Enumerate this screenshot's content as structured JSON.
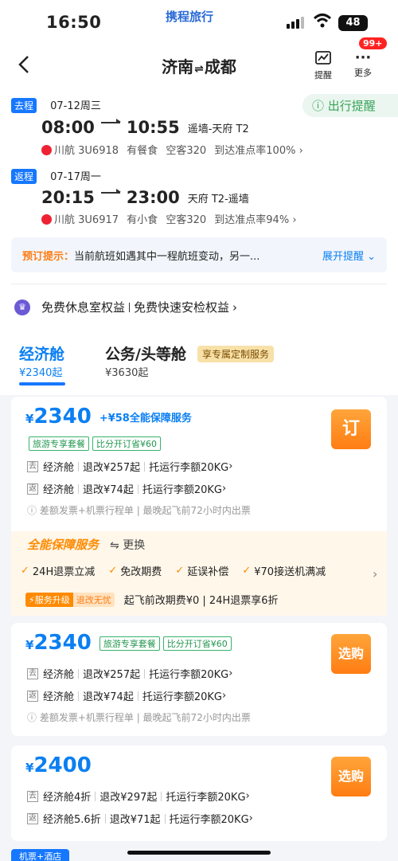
{
  "status": {
    "time": "16:50",
    "brand": "携程旅行",
    "battery": "48"
  },
  "header": {
    "route_from": "济南",
    "route_to": "成都",
    "remind_label": "提醒",
    "more_label": "更多",
    "badge": "99+"
  },
  "outbound": {
    "tag": "去程",
    "date": "07-12周三",
    "depart": "08:00",
    "arrive": "10:55",
    "airports": "遥墙-天府 T2",
    "airline": "川航 3U6918",
    "meal": "有餐食",
    "aircraft": "空客320",
    "ontime": "到达准点率100%"
  },
  "trip_remind": "出行提醒",
  "return": {
    "tag": "返程",
    "date": "07-17周一",
    "depart": "20:15",
    "arrive": "23:00",
    "airports": "天府 T2-遥墙",
    "airline": "川航 3U6917",
    "meal": "有小食",
    "aircraft": "空客320",
    "ontime": "到达准点率94%"
  },
  "tip": {
    "label": "预订提示：",
    "text": "当前航班如遇其中一程航班变动，另一...",
    "expand": "展开提醒"
  },
  "perks": {
    "lounge": "免费休息室权益",
    "security": "免费快速安检权益"
  },
  "tabs": {
    "economy": {
      "label": "经济舱",
      "price": "¥2340起"
    },
    "business": {
      "label": "公务/头等舱",
      "price": "¥3630起",
      "badge": "享专属定制服务"
    }
  },
  "cards": [
    {
      "price": "2340",
      "extra": "+¥58全能保障服务",
      "pills": [
        "旅游专享套餐",
        "比分开订省¥60"
      ],
      "out": {
        "tag": "去",
        "cabin": "经济舱",
        "change": "退改¥257起",
        "baggage": "托运行李额20KG"
      },
      "ret": {
        "tag": "返",
        "cabin": "经济舱",
        "change": "退改¥74起",
        "baggage": "托运行李额20KG"
      },
      "note": "差额发票+机票行程单 | 最晚起飞前72小时内出票",
      "button": "订"
    },
    {
      "price": "2340",
      "pills": [
        "旅游专享套餐",
        "比分开订省¥60"
      ],
      "out": {
        "tag": "去",
        "cabin": "经济舱",
        "change": "退改¥257起",
        "baggage": "托运行李额20KG"
      },
      "ret": {
        "tag": "返",
        "cabin": "经济舱",
        "change": "退改¥74起",
        "baggage": "托运行李额20KG"
      },
      "note": "差额发票+机票行程单 | 最晚起飞前72小时内出票",
      "button": "选购"
    },
    {
      "price": "2400",
      "out": {
        "tag": "去",
        "cabin": "经济舱4折",
        "change": "退改¥297起",
        "baggage": "托运行李额20KG"
      },
      "ret": {
        "tag": "返",
        "cabin": "经济舱5.6折",
        "change": "退改¥71起",
        "baggage": "托运行李额20KG"
      },
      "button": "选购"
    }
  ],
  "service": {
    "title": "全能保障服务",
    "swap": "更换",
    "items": [
      "24H退票立减",
      "免改期费",
      "延误补偿",
      "¥70接送机满减"
    ],
    "upgrade_tag": "服务升级",
    "upgrade_sub": "退改无忧",
    "upgrade_text": "起飞前改期费¥0 | 24H退票享6折"
  },
  "bottom_tab": "机票+酒店"
}
